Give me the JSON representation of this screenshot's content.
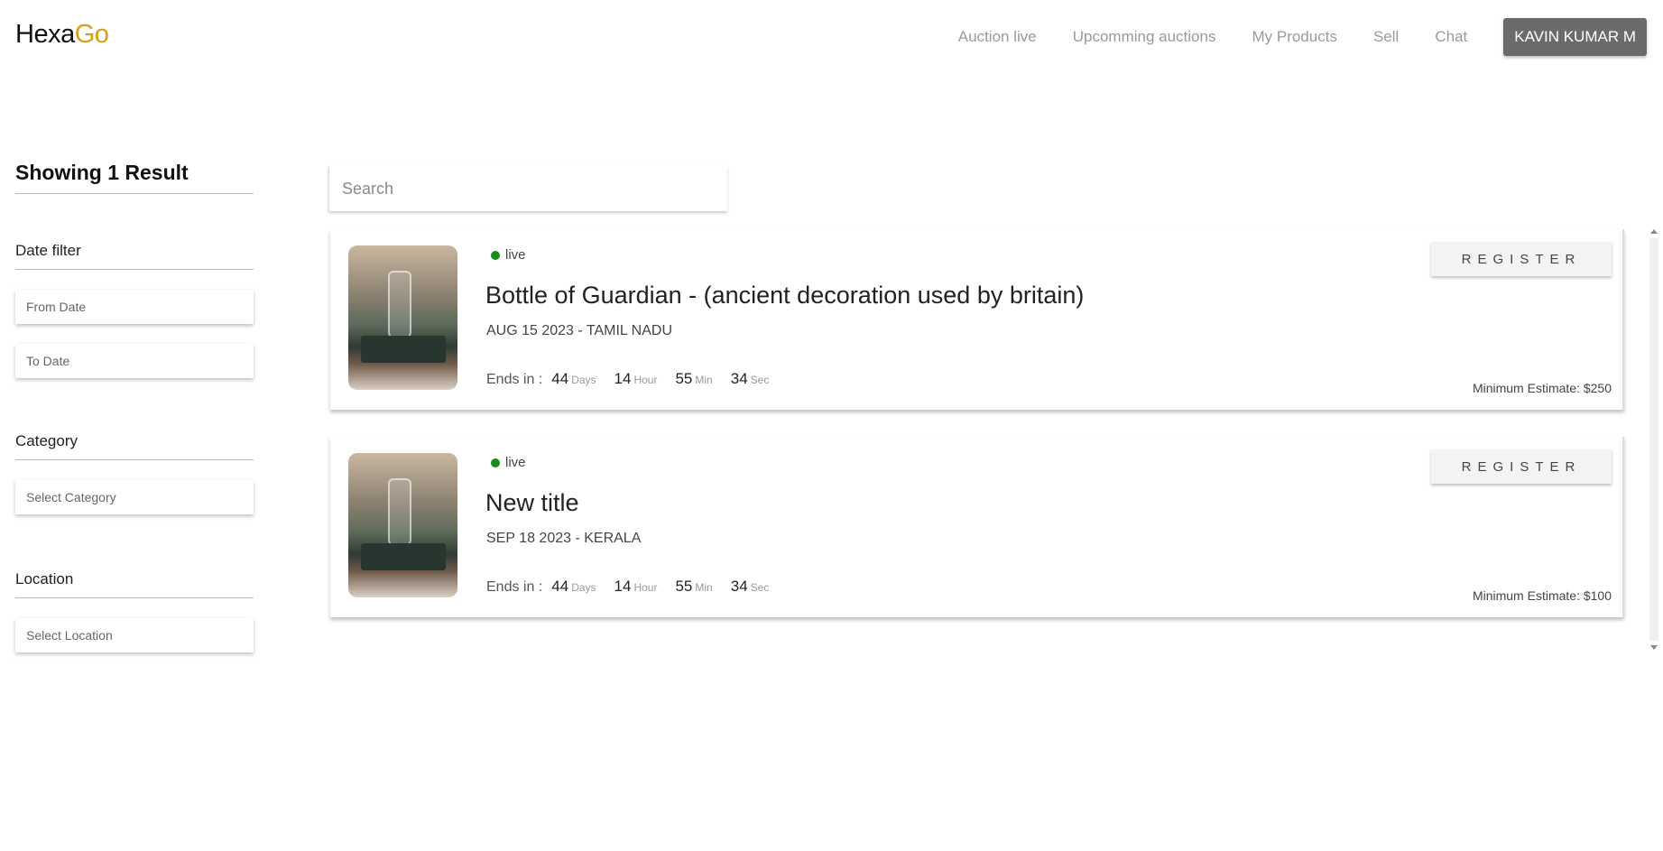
{
  "header": {
    "logo_part1": "Hexa",
    "logo_part2": "Go",
    "nav": [
      {
        "label": "Auction live"
      },
      {
        "label": "Upcomming auctions"
      },
      {
        "label": "My Products"
      },
      {
        "label": "Sell"
      },
      {
        "label": "Chat"
      }
    ],
    "user_label": "KAVIN KUMAR M"
  },
  "sidebar": {
    "results_title": "Showing 1 Result",
    "date_filter": {
      "heading": "Date filter",
      "from_placeholder": "From Date",
      "to_placeholder": "To Date"
    },
    "category": {
      "heading": "Category",
      "placeholder": "Select Category"
    },
    "location": {
      "heading": "Location",
      "placeholder": "Select Location"
    }
  },
  "search": {
    "placeholder": "Search"
  },
  "cards": [
    {
      "status": "live",
      "title": "Bottle of Guardian - (ancient decoration used by britain)",
      "meta": "AUG 15 2023 - TAMIL NADU",
      "ends_label": "Ends in :",
      "days": "44",
      "days_unit": "Days",
      "hours": "14",
      "hours_unit": "Hour",
      "mins": "55",
      "mins_unit": "Min",
      "secs": "34",
      "secs_unit": "Sec",
      "register_label": "REGISTER",
      "min_estimate": "Minimum Estimate: $250"
    },
    {
      "status": "live",
      "title": "New title",
      "meta": "SEP 18 2023 - KERALA",
      "ends_label": "Ends in :",
      "days": "44",
      "days_unit": "Days",
      "hours": "14",
      "hours_unit": "Hour",
      "mins": "55",
      "mins_unit": "Min",
      "secs": "34",
      "secs_unit": "Sec",
      "register_label": "REGISTER",
      "min_estimate": "Minimum Estimate: $100"
    }
  ],
  "colors": {
    "logo_accent": "#d4a017",
    "live_dot": "#1a8a1a",
    "user_button_bg": "#6b6b6b"
  }
}
